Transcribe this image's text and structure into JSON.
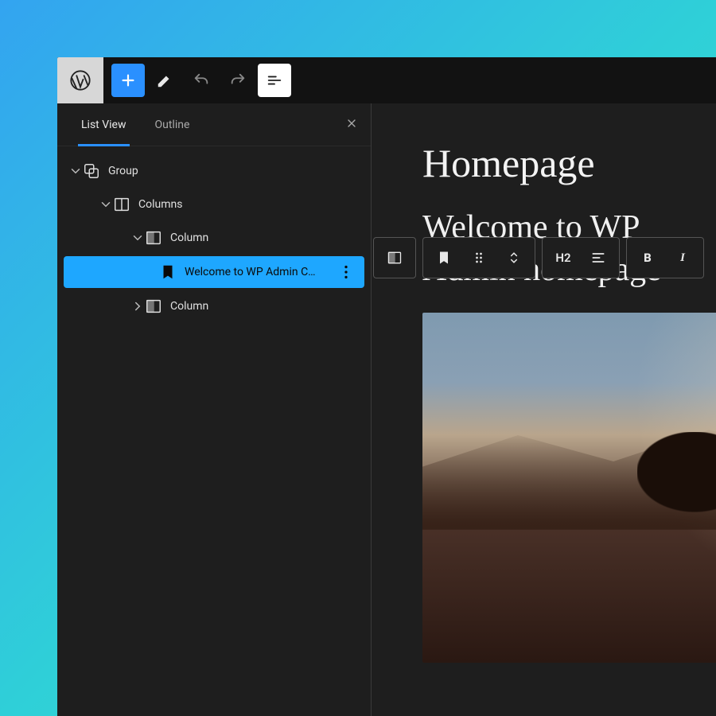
{
  "toolbar": {
    "add_label": "Add block",
    "edit_label": "Edit",
    "undo_label": "Undo",
    "redo_label": "Redo",
    "listview_label": "List View"
  },
  "sidebar": {
    "tabs": {
      "listview": "List View",
      "outline": "Outline"
    },
    "active_tab": "listview",
    "tree": [
      {
        "label": "Group",
        "icon": "group",
        "depth": 0,
        "expandable": true,
        "expanded": true
      },
      {
        "label": "Columns",
        "icon": "columns",
        "depth": 1,
        "expandable": true,
        "expanded": true
      },
      {
        "label": "Column",
        "icon": "column",
        "depth": 2,
        "expandable": true,
        "expanded": true
      },
      {
        "label": "Welcome to WP Admin C…",
        "icon": "bookmark",
        "depth": 3,
        "selected": true
      },
      {
        "label": "Column",
        "icon": "column",
        "depth": 2,
        "expandable": true,
        "expanded": false
      }
    ]
  },
  "canvas": {
    "page_title": "Homepage",
    "heading_text": "Welcome to WP Admin homepage"
  },
  "block_toolbar": {
    "heading_level": "H2",
    "bold": "B",
    "italic": "I"
  },
  "colors": {
    "accent": "#2a90ff",
    "selection": "#1ea7ff",
    "bg": "#1e1e1e",
    "topbar": "#121212"
  }
}
